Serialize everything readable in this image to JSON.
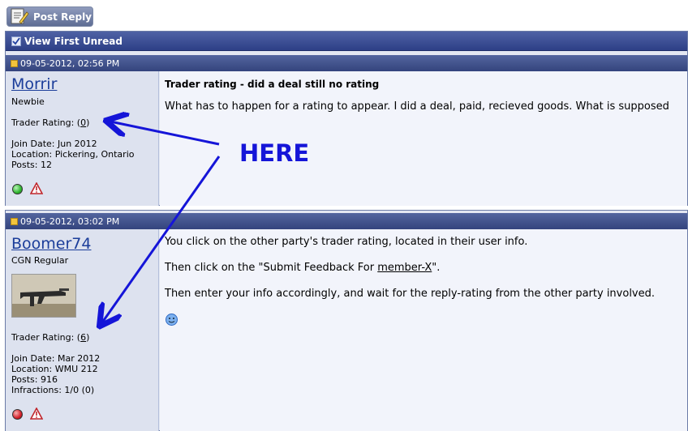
{
  "toolbar": {
    "post_reply_label": "Post Reply"
  },
  "thread": {
    "view_first_unread_label": "View First Unread"
  },
  "posts": [
    {
      "date": "09-05-2012, 02:56 PM",
      "username": "Morrir",
      "user_title": "Newbie",
      "trader_rating_label": "Trader Rating: (",
      "trader_rating_value": "0",
      "trader_rating_close": ")",
      "join_date": "Join Date: Jun 2012",
      "location": "Location: Pickering, Ontario",
      "posts": "Posts: 12",
      "online_status_color": "#2fb52f",
      "title": "Trader rating - did a deal still no rating",
      "body": "What has to happen for a rating to appear. I did a deal, paid, recieved goods. What is supposed"
    },
    {
      "date": "09-05-2012, 03:02 PM",
      "username": "Boomer74",
      "user_title": "CGN Regular",
      "trader_rating_label": "Trader Rating: (",
      "trader_rating_value": "6",
      "trader_rating_close": ")",
      "join_date": "Join Date: Mar 2012",
      "location": "Location: WMU 212",
      "posts": "Posts: 916",
      "infractions": "Infractions: 1/0 (0)",
      "online_status_color": "#d4202a",
      "body_line1": "You click on the other party's trader rating, located in their user info.",
      "body_line2_pre": "Then click on the \"Submit Feedback For ",
      "body_line2_link": "member-X",
      "body_line2_post": "\".",
      "body_line3": "Then enter your info accordingly, and wait for the reply-rating from the other party involved."
    }
  ],
  "annotation": {
    "label": "HERE",
    "color": "#1515d8"
  }
}
